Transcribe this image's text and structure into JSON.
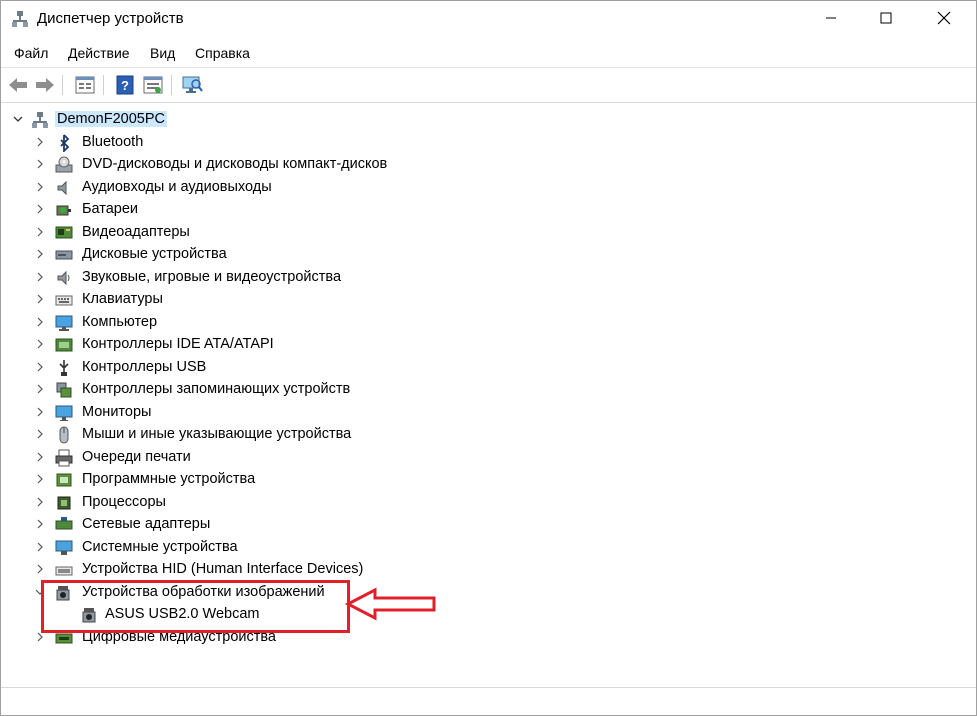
{
  "window": {
    "title": "Диспетчер устройств"
  },
  "menu": [
    "Файл",
    "Действие",
    "Вид",
    "Справка"
  ],
  "toolbar": {
    "back": "arrow-left-icon",
    "forward": "arrow-right-icon",
    "properties": "properties-icon",
    "help": "help-icon",
    "update": "update-driver-icon",
    "scan": "scan-hardware-icon"
  },
  "tree": {
    "root": "DemonF2005PC",
    "categories": [
      {
        "label": "Bluetooth",
        "icon": "bluetooth-icon"
      },
      {
        "label": "DVD-дисководы и дисководы компакт-дисков",
        "icon": "dvd-drive-icon"
      },
      {
        "label": "Аудиовходы и аудиовыходы",
        "icon": "speaker-icon"
      },
      {
        "label": "Батареи",
        "icon": "battery-icon"
      },
      {
        "label": "Видеоадаптеры",
        "icon": "display-adapter-icon"
      },
      {
        "label": "Дисковые устройства",
        "icon": "disk-drive-icon"
      },
      {
        "label": "Звуковые, игровые и видеоустройства",
        "icon": "sound-icon"
      },
      {
        "label": "Клавиатуры",
        "icon": "keyboard-icon"
      },
      {
        "label": "Компьютер",
        "icon": "computer-icon"
      },
      {
        "label": "Контроллеры IDE ATA/ATAPI",
        "icon": "ide-controller-icon"
      },
      {
        "label": "Контроллеры USB",
        "icon": "usb-icon"
      },
      {
        "label": "Контроллеры запоминающих устройств",
        "icon": "storage-controller-icon"
      },
      {
        "label": "Мониторы",
        "icon": "monitor-icon"
      },
      {
        "label": "Мыши и иные указывающие устройства",
        "icon": "mouse-icon"
      },
      {
        "label": "Очереди печати",
        "icon": "printer-icon"
      },
      {
        "label": "Программные устройства",
        "icon": "software-device-icon"
      },
      {
        "label": "Процессоры",
        "icon": "processor-icon"
      },
      {
        "label": "Сетевые адаптеры",
        "icon": "network-adapter-icon"
      },
      {
        "label": "Системные устройства",
        "icon": "system-device-icon"
      },
      {
        "label": "Устройства HID (Human Interface Devices)",
        "icon": "hid-icon"
      },
      {
        "label": "Устройства обработки изображений",
        "icon": "camera-icon",
        "expanded": true,
        "children": [
          {
            "label": "ASUS USB2.0 Webcam",
            "icon": "webcam-icon"
          }
        ]
      },
      {
        "label": "Цифровые медиаустройства",
        "icon": "media-device-icon"
      }
    ]
  },
  "annotation": {
    "box_color": "#e0202a"
  },
  "colors": {
    "selection": "#cce8ff",
    "accent": "#e0202a"
  }
}
